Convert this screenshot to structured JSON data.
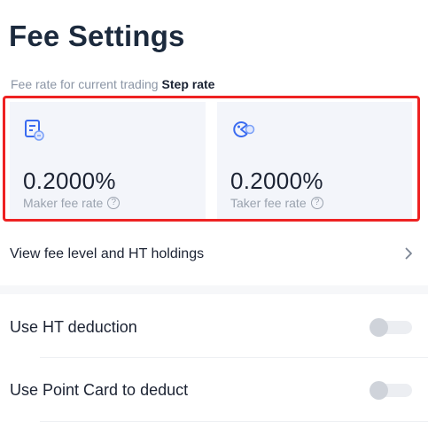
{
  "header": {
    "title": "Fee Settings"
  },
  "fee_rate": {
    "caption": "Fee rate for current trading",
    "mode": "Step rate"
  },
  "cards": {
    "maker": {
      "value": "0.2000%",
      "label": "Maker fee rate",
      "icon": "document-coin-icon"
    },
    "taker": {
      "value": "0.2000%",
      "label": "Taker fee rate",
      "icon": "pacman-coin-icon"
    },
    "help_glyph": "?"
  },
  "links": {
    "fee_level": "View fee level and HT holdings"
  },
  "settings": {
    "ht_deduction": {
      "label": "Use HT deduction",
      "enabled": false
    },
    "point_card": {
      "label": "Use Point Card to deduct",
      "enabled": false
    }
  },
  "colors": {
    "accent": "#3a6bf0",
    "highlight": "#ee2222",
    "card_bg": "#f3f5fa",
    "toggle_off": "#cfd3da"
  }
}
